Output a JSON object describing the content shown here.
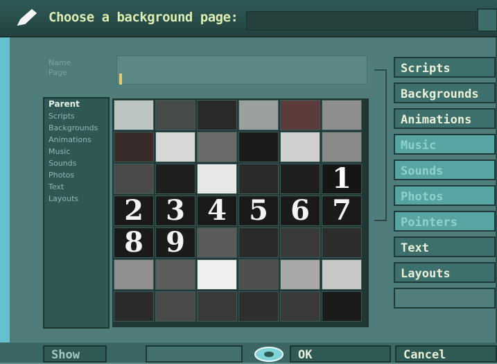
{
  "title": "Choose a background page:",
  "name_row": {
    "label_line1": "Name",
    "label_line2": "Page",
    "field_value": ""
  },
  "categories": {
    "selected": "Parent",
    "items": [
      "Parent",
      "Scripts",
      "Backgrounds",
      "Animations",
      "Music",
      "Sounds",
      "Photos",
      "Text",
      "Layouts"
    ]
  },
  "tiles": [
    {
      "bg": "#bcc4c4",
      "fg": "",
      "num": ""
    },
    {
      "bg": "#474c4a",
      "fg": "",
      "num": ""
    },
    {
      "bg": "#2a2a2a",
      "fg": "",
      "num": ""
    },
    {
      "bg": "#9aa09e",
      "fg": "",
      "num": ""
    },
    {
      "bg": "#5c3b3b",
      "fg": "",
      "num": ""
    },
    {
      "bg": "#8e8e8e",
      "fg": "",
      "num": ""
    },
    {
      "bg": "#3a2b2b",
      "fg": "",
      "num": ""
    },
    {
      "bg": "#d8d8d8",
      "fg": "",
      "num": ""
    },
    {
      "bg": "#6a6a6a",
      "fg": "",
      "num": ""
    },
    {
      "bg": "#1b1b1b",
      "fg": "",
      "num": ""
    },
    {
      "bg": "#d0d0d0",
      "fg": "",
      "num": ""
    },
    {
      "bg": "#8a8a8a",
      "fg": "",
      "num": ""
    },
    {
      "bg": "#4a4a4a",
      "fg": "",
      "num": ""
    },
    {
      "bg": "#1f1f1f",
      "fg": "",
      "num": ""
    },
    {
      "bg": "#e8e8e8",
      "fg": "",
      "num": ""
    },
    {
      "bg": "#2a2a2a",
      "fg": "",
      "num": ""
    },
    {
      "bg": "#1e1e1e",
      "fg": "",
      "num": ""
    },
    {
      "bg": "#151515",
      "fg": "#ffffff",
      "num": "1"
    },
    {
      "bg": "#1a1a1a",
      "fg": "#f4f4f4",
      "num": "2"
    },
    {
      "bg": "#1a1a1a",
      "fg": "#f4f4f4",
      "num": "3"
    },
    {
      "bg": "#1a1a1a",
      "fg": "#f4f4f4",
      "num": "4"
    },
    {
      "bg": "#1a1a1a",
      "fg": "#f4f4f4",
      "num": "5"
    },
    {
      "bg": "#1a1a1a",
      "fg": "#f4f4f4",
      "num": "6"
    },
    {
      "bg": "#1a1a1a",
      "fg": "#f4f4f4",
      "num": "7"
    },
    {
      "bg": "#1a1a1a",
      "fg": "#f4f4f4",
      "num": "8"
    },
    {
      "bg": "#1a1a1a",
      "fg": "#f4f4f4",
      "num": "9"
    },
    {
      "bg": "#5a5a5a",
      "fg": "",
      "num": ""
    },
    {
      "bg": "#2a2a2a",
      "fg": "",
      "num": ""
    },
    {
      "bg": "#3a3a3a",
      "fg": "",
      "num": ""
    },
    {
      "bg": "#2c2c2c",
      "fg": "",
      "num": ""
    },
    {
      "bg": "#8f8f8f",
      "fg": "",
      "num": ""
    },
    {
      "bg": "#5c5c5c",
      "fg": "",
      "num": ""
    },
    {
      "bg": "#efefef",
      "fg": "",
      "num": ""
    },
    {
      "bg": "#4f4f4f",
      "fg": "",
      "num": ""
    },
    {
      "bg": "#a8a8a8",
      "fg": "",
      "num": ""
    },
    {
      "bg": "#c7c7c7",
      "fg": "",
      "num": ""
    },
    {
      "bg": "#2b2b2b",
      "fg": "",
      "num": ""
    },
    {
      "bg": "#4a4a4a",
      "fg": "",
      "num": ""
    },
    {
      "bg": "#3a3a3a",
      "fg": "",
      "num": ""
    },
    {
      "bg": "#2f2f2f",
      "fg": "",
      "num": ""
    },
    {
      "bg": "#3a3a3a",
      "fg": "",
      "num": ""
    },
    {
      "bg": "#1b1b1b",
      "fg": "",
      "num": ""
    }
  ],
  "right_buttons": [
    {
      "label": "Scripts",
      "style": "strong"
    },
    {
      "label": "Backgrounds",
      "style": "strong"
    },
    {
      "label": "Animations",
      "style": "strong"
    },
    {
      "label": "Music",
      "style": "dim"
    },
    {
      "label": "Sounds",
      "style": "dim"
    },
    {
      "label": "Photos",
      "style": "dim"
    },
    {
      "label": "Pointers",
      "style": "dim"
    },
    {
      "label": "Text",
      "style": "strong"
    },
    {
      "label": "Layouts",
      "style": "strong"
    },
    {
      "label": "",
      "style": "blank"
    }
  ],
  "bottom": {
    "show_label": "Show",
    "ok_label": "OK",
    "cancel_label": "Cancel",
    "small_label": ""
  }
}
